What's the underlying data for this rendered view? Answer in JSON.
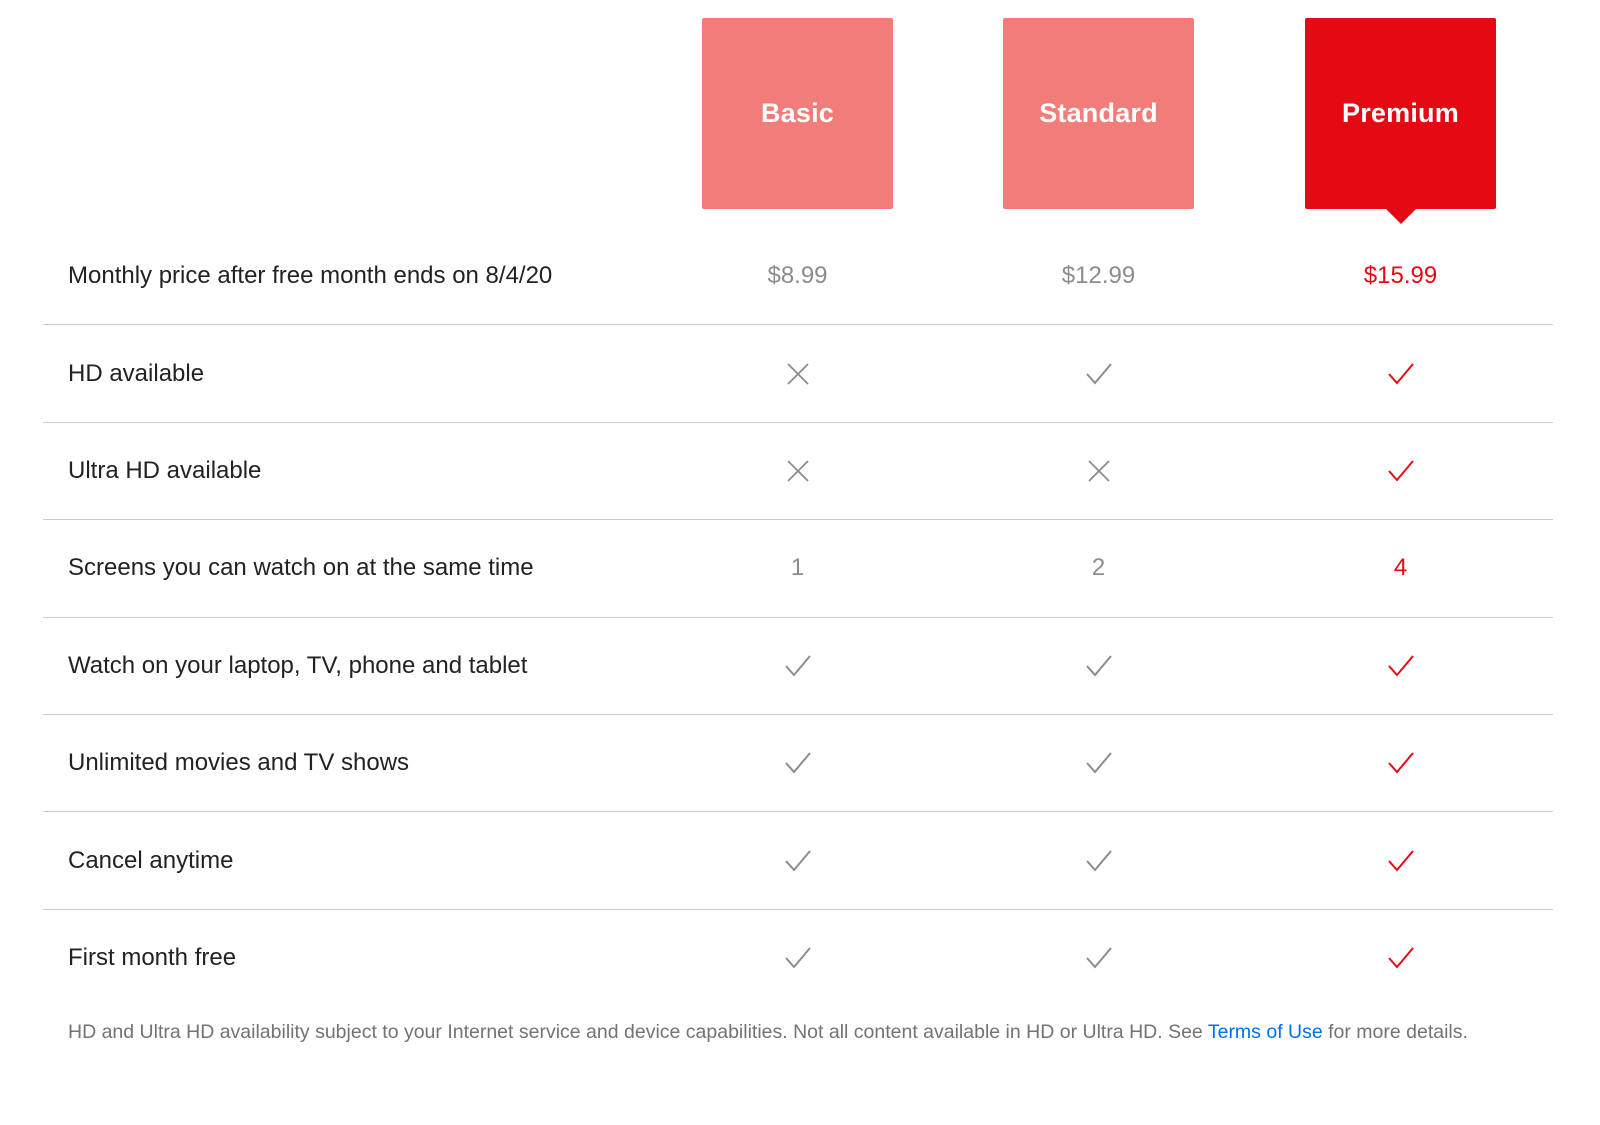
{
  "plans": [
    {
      "name": "Basic",
      "selected": false,
      "color": "#f27c7a"
    },
    {
      "name": "Standard",
      "selected": false,
      "color": "#f27c7a"
    },
    {
      "name": "Premium",
      "selected": true,
      "color": "#e50914"
    }
  ],
  "rows": [
    {
      "label": "Monthly price after free month ends on 8/4/20",
      "values": [
        "$8.99",
        "$12.99",
        "$15.99"
      ]
    },
    {
      "label": "HD available",
      "icons": [
        "x-icon",
        "check-icon",
        "check-icon"
      ]
    },
    {
      "label": "Ultra HD available",
      "icons": [
        "x-icon",
        "x-icon",
        "check-icon"
      ]
    },
    {
      "label": "Screens you can watch on at the same time",
      "values": [
        "1",
        "2",
        "4"
      ]
    },
    {
      "label": "Watch on your laptop, TV, phone and tablet",
      "icons": [
        "check-icon",
        "check-icon",
        "check-icon"
      ]
    },
    {
      "label": "Unlimited movies and TV shows",
      "icons": [
        "check-icon",
        "check-icon",
        "check-icon"
      ]
    },
    {
      "label": "Cancel anytime",
      "icons": [
        "check-icon",
        "check-icon",
        "check-icon"
      ]
    },
    {
      "label": "First month free",
      "icons": [
        "check-icon",
        "check-icon",
        "check-icon"
      ]
    }
  ],
  "footnote": {
    "text_before": "HD and Ultra HD availability subject to your Internet service and device capabilities. Not all content available in HD or Ultra HD. See ",
    "link": "Terms of Use",
    "text_after": " for more details."
  },
  "colors": {
    "accent": "#e50914",
    "muted_card": "#f27c7a",
    "muted_text": "#8c8c8c",
    "link": "#0071eb"
  }
}
